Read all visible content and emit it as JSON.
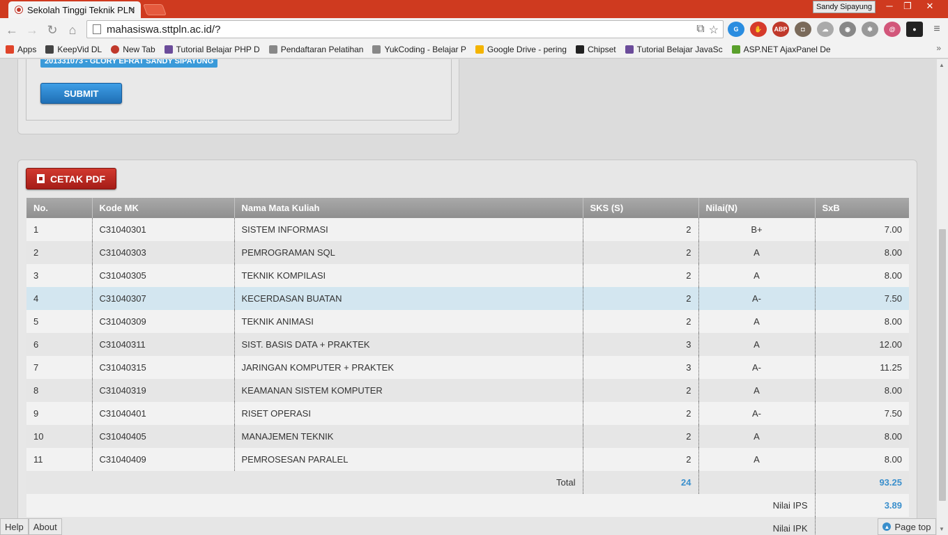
{
  "browser": {
    "tab_title": "Sekolah Tinggi Teknik PLN",
    "profile_name": "Sandy Sipayung",
    "url": "mahasiswa.sttpln.ac.id/?",
    "bookmarks": [
      {
        "label": "Apps",
        "color": "#e0442a"
      },
      {
        "label": "KeepVid DL",
        "color": "#444"
      },
      {
        "label": "New Tab",
        "color": "#c0392b"
      },
      {
        "label": "Tutorial Belajar PHP D",
        "color": "#6b4c9a"
      },
      {
        "label": "Pendaftaran Pelatihan",
        "color": "#888"
      },
      {
        "label": "YukCoding - Belajar P",
        "color": "#888"
      },
      {
        "label": "Google Drive - pering",
        "color": "#f4b400"
      },
      {
        "label": "Chipset",
        "color": "#222"
      },
      {
        "label": "Tutorial Belajar JavaSc",
        "color": "#6b4c9a"
      },
      {
        "label": "ASP.NET AjaxPanel De",
        "color": "#5aa02c"
      }
    ]
  },
  "form": {
    "student_badge": "201331073 - GLORY EFRAT SANDY SIPAYUNG",
    "submit_label": "SUBMIT"
  },
  "grades": {
    "pdf_label": "CETAK PDF",
    "headers": [
      "No.",
      "Kode MK",
      "Nama Mata Kuliah",
      "SKS (S)",
      "Nilai(N)",
      "SxB"
    ],
    "rows": [
      {
        "no": "1",
        "kode": "C31040301",
        "nama": "SISTEM INFORMASI",
        "sks": "2",
        "nilai": "B+",
        "sxb": "7.00"
      },
      {
        "no": "2",
        "kode": "C31040303",
        "nama": "PEMROGRAMAN SQL",
        "sks": "2",
        "nilai": "A",
        "sxb": "8.00"
      },
      {
        "no": "3",
        "kode": "C31040305",
        "nama": "TEKNIK KOMPILASI",
        "sks": "2",
        "nilai": "A",
        "sxb": "8.00"
      },
      {
        "no": "4",
        "kode": "C31040307",
        "nama": "KECERDASAN BUATAN",
        "sks": "2",
        "nilai": "A-",
        "sxb": "7.50"
      },
      {
        "no": "5",
        "kode": "C31040309",
        "nama": "TEKNIK ANIMASI",
        "sks": "2",
        "nilai": "A",
        "sxb": "8.00"
      },
      {
        "no": "6",
        "kode": "C31040311",
        "nama": "SIST. BASIS DATA + PRAKTEK",
        "sks": "3",
        "nilai": "A",
        "sxb": "12.00"
      },
      {
        "no": "7",
        "kode": "C31040315",
        "nama": "JARINGAN KOMPUTER + PRAKTEK",
        "sks": "3",
        "nilai": "A-",
        "sxb": "11.25"
      },
      {
        "no": "8",
        "kode": "C31040319",
        "nama": "KEAMANAN SISTEM KOMPUTER",
        "sks": "2",
        "nilai": "A",
        "sxb": "8.00"
      },
      {
        "no": "9",
        "kode": "C31040401",
        "nama": "RISET OPERASI",
        "sks": "2",
        "nilai": "A-",
        "sxb": "7.50"
      },
      {
        "no": "10",
        "kode": "C31040405",
        "nama": "MANAJEMEN TEKNIK",
        "sks": "2",
        "nilai": "A",
        "sxb": "8.00"
      },
      {
        "no": "11",
        "kode": "C31040409",
        "nama": "PEMROSESAN PARALEL",
        "sks": "2",
        "nilai": "A",
        "sxb": "8.00"
      }
    ],
    "total_label": "Total",
    "total_sks": "24",
    "total_sxb": "93.25",
    "ips_label": "Nilai IPS",
    "ips_value": "3.89",
    "ipk_label": "Nilai IPK"
  },
  "status": {
    "help": "Help",
    "about": "About",
    "page_top": "Page top"
  }
}
